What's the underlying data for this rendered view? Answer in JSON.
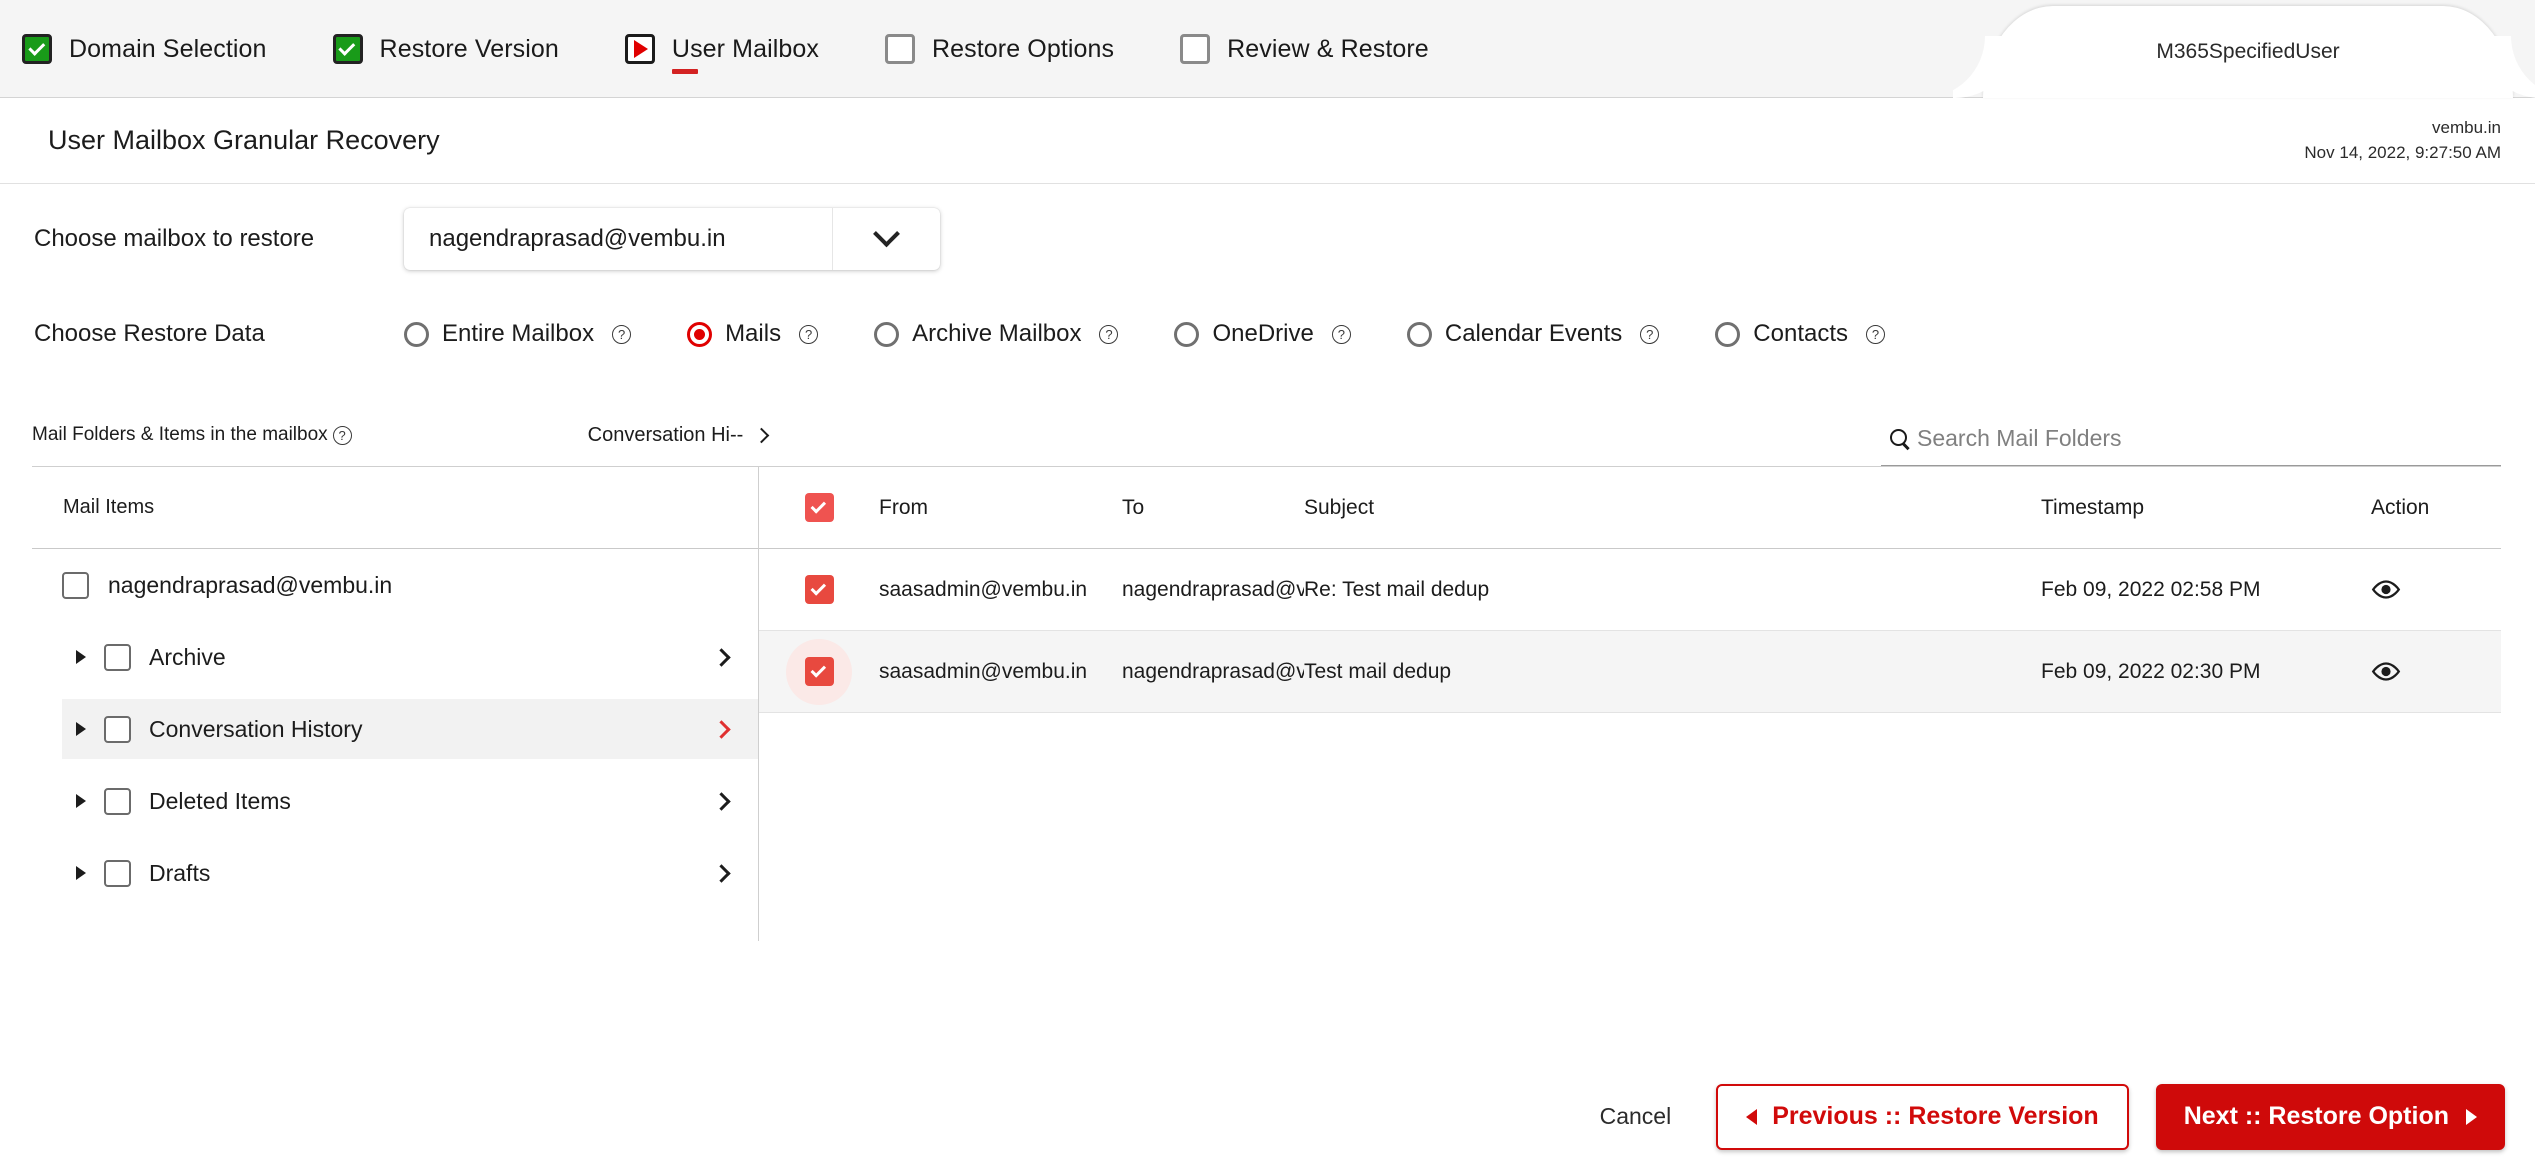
{
  "wizard": {
    "steps": [
      {
        "label": "Domain Selection",
        "state": "done",
        "icon": "check-icon"
      },
      {
        "label": "Restore Version",
        "state": "done",
        "icon": "check-icon"
      },
      {
        "label": "User Mailbox",
        "state": "current",
        "icon": "play-icon"
      },
      {
        "label": "Restore Options",
        "state": "todo",
        "icon": "empty-checkbox-icon"
      },
      {
        "label": "Review & Restore",
        "state": "todo",
        "icon": "empty-checkbox-icon"
      }
    ],
    "user_tab": "M365SpecifiedUser",
    "colors": {
      "done": "#199b19",
      "current": "#e00000",
      "todo": "#8a8a8a"
    }
  },
  "header": {
    "title": "User Mailbox Granular Recovery",
    "domain": "vembu.in",
    "timestamp": "Nov 14, 2022, 9:27:50 AM"
  },
  "form": {
    "mailbox_label": "Choose mailbox to restore",
    "mailbox_value": "nagendraprasad@vembu.in",
    "restore_data_label": "Choose Restore Data",
    "restore_options": [
      {
        "label": "Entire Mailbox",
        "selected": false,
        "help": "?"
      },
      {
        "label": "Mails",
        "selected": true,
        "help": "?"
      },
      {
        "label": "Archive Mailbox",
        "selected": false,
        "help": "?"
      },
      {
        "label": "OneDrive",
        "selected": false,
        "help": "?"
      },
      {
        "label": "Calendar Events",
        "selected": false,
        "help": "?"
      },
      {
        "label": "Contacts",
        "selected": false,
        "help": "?"
      }
    ],
    "accent_selected": "#e00000"
  },
  "subheader": {
    "folders_label": "Mail Folders & Items in the mailbox",
    "folders_help": "?",
    "breadcrumb": "Conversation Hi--",
    "search_placeholder": "Search Mail Folders",
    "search_value": ""
  },
  "tree": {
    "header": "Mail Items",
    "root": {
      "label": "nagendraprasad@vembu.in",
      "checked": false
    },
    "items": [
      {
        "label": "Archive",
        "checked": false,
        "selected": false,
        "expandable": true
      },
      {
        "label": "Conversation History",
        "checked": false,
        "selected": true,
        "expandable": true
      },
      {
        "label": "Deleted Items",
        "checked": false,
        "selected": false,
        "expandable": true
      },
      {
        "label": "Drafts",
        "checked": false,
        "selected": false,
        "expandable": true
      }
    ]
  },
  "table": {
    "columns": [
      "From",
      "To",
      "Subject",
      "Timestamp",
      "Action"
    ],
    "select_all": true,
    "rows": [
      {
        "checked": true,
        "from": "saasadmin@vembu.in",
        "to": "nagendraprasad@vem|",
        "subject": "Re: Test mail dedup",
        "timestamp": "Feb 09, 2022 02:58 PM",
        "action": "eye-icon",
        "highlight": false
      },
      {
        "checked": true,
        "from": "saasadmin@vembu.in",
        "to": "nagendraprasad@vem|",
        "subject": "Test mail dedup",
        "timestamp": "Feb 09, 2022 02:30 PM",
        "action": "eye-icon",
        "highlight": true
      }
    ],
    "checkbox_color": "#ef5350"
  },
  "footer": {
    "cancel": "Cancel",
    "previous": "Previous :: Restore Version",
    "next": "Next :: Restore Option",
    "primary_color": "#cf0a0a"
  }
}
